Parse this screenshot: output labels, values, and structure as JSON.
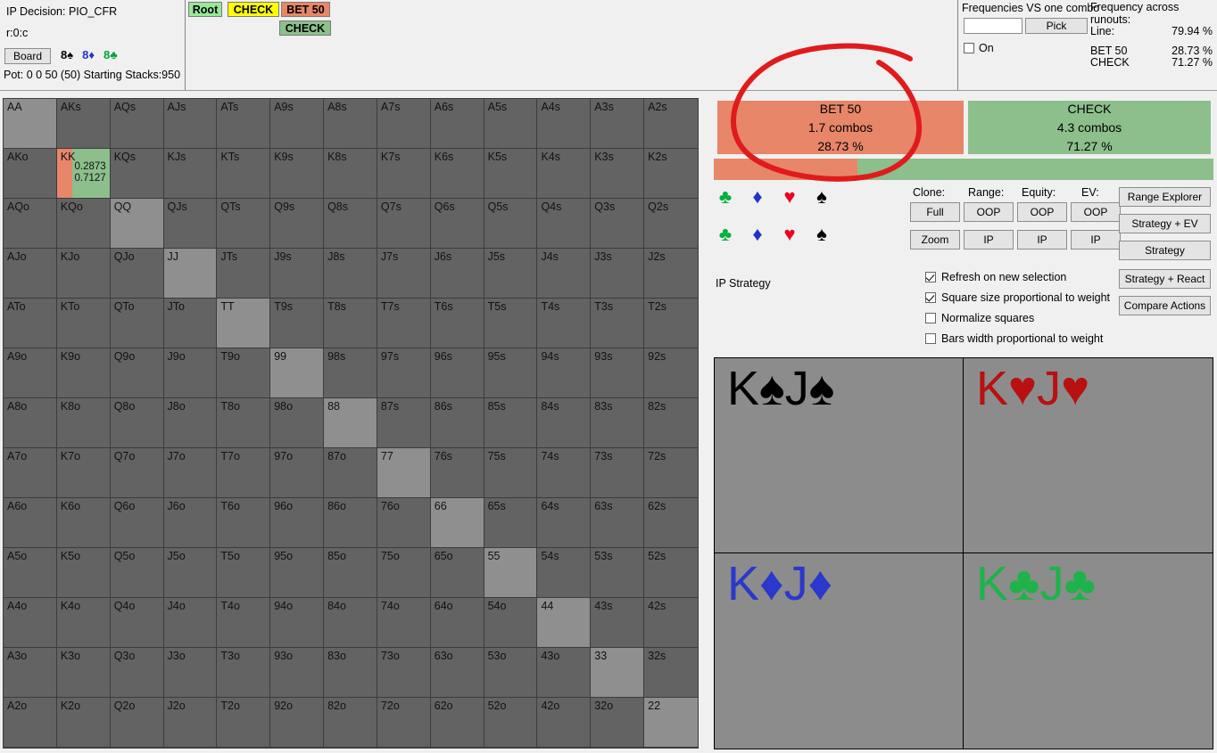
{
  "header": {
    "ip_decision_label": "IP Decision:  PIO_CFR",
    "line_path": "r:0:c",
    "board_button": "Board",
    "board_cards": [
      {
        "text": "8♠",
        "suit": "spade"
      },
      {
        "text": "8♦",
        "suit": "diamond"
      },
      {
        "text": "8♣",
        "suit": "club"
      }
    ],
    "pot_info": "Pot: 0 0 50 (50) Starting Stacks:950"
  },
  "action_tree": {
    "nodes": [
      {
        "label": "Root",
        "color": "#98e89a"
      },
      {
        "label": "CHECK",
        "color": "#ffff00"
      },
      {
        "label": "BET 50",
        "color": "#e8866a"
      },
      {
        "label": "CHECK",
        "color": "#8cc08c"
      }
    ]
  },
  "frequencies_panel": {
    "title": "Frequencies VS one combo",
    "input_value": "",
    "input_placeholder": "",
    "pick_button": "Pick",
    "on_checkbox_label": "On",
    "on_checked": false
  },
  "runouts_panel": {
    "title": "Frequency across runouts:",
    "line_label": "Line:",
    "line_value": "79.94 %",
    "rows": [
      {
        "label": "BET 50",
        "value": "28.73 %"
      },
      {
        "label": "CHECK",
        "value": "71.27 %"
      }
    ]
  },
  "actions": {
    "bet": {
      "name": "BET 50",
      "combos": "1.7 combos",
      "percent": "28.73 %",
      "color": "#e8866a",
      "weight": 28.73
    },
    "check": {
      "name": "CHECK",
      "combos": "4.3 combos",
      "percent": "71.27 %",
      "color": "#8cbf8c",
      "weight": 71.27
    }
  },
  "strategy_label": "IP Strategy",
  "suit_rows": [
    [
      "club",
      "diamond",
      "heart",
      "spade"
    ],
    [
      "club",
      "diamond",
      "heart",
      "spade"
    ]
  ],
  "control_headers": [
    "Clone:",
    "Range:",
    "Equity:",
    "EV:"
  ],
  "control_buttons": {
    "row1": [
      "Full",
      "OOP",
      "OOP",
      "OOP"
    ],
    "row2": [
      "Zoom",
      "IP",
      "IP",
      "IP"
    ]
  },
  "side_buttons": [
    "Range Explorer",
    "Strategy + EV",
    "Strategy",
    "Strategy + React",
    "Compare Actions"
  ],
  "checkboxes": [
    {
      "label": "Refresh on new selection",
      "checked": true
    },
    {
      "label": "Square size proportional to weight",
      "checked": true
    },
    {
      "label": "Normalize squares",
      "checked": false
    },
    {
      "label": "Bars width proportional to weight",
      "checked": false
    }
  ],
  "combo_cells": [
    {
      "rank1": "K",
      "suit1": "♠",
      "rank2": "J",
      "suit2": "♠",
      "color": "c-spade"
    },
    {
      "rank1": "K",
      "suit1": "♥",
      "rank2": "J",
      "suit2": "♥",
      "color": "c-heart"
    },
    {
      "rank1": "K",
      "suit1": "♦",
      "rank2": "J",
      "suit2": "♦",
      "color": "c-diam"
    },
    {
      "rank1": "K",
      "suit1": "♣",
      "rank2": "J",
      "suit2": "♣",
      "color": "c-club"
    }
  ],
  "matrix": {
    "ranks": [
      "A",
      "K",
      "Q",
      "J",
      "T",
      "9",
      "8",
      "7",
      "6",
      "5",
      "4",
      "3",
      "2"
    ],
    "selected_cell": {
      "label": "KK",
      "bet_value": "0.2873",
      "check_value": "0.7127",
      "bet_pct": 28.73,
      "check_pct": 71.27,
      "bet_color": "#e8866a",
      "check_color": "#8cbf8c"
    },
    "cell_bg": "#636363",
    "pair_bg": "#8f8f8f"
  },
  "annotation": {
    "type": "hand-drawn-ellipse",
    "color": "#e01b1b",
    "target": "BET 50"
  }
}
